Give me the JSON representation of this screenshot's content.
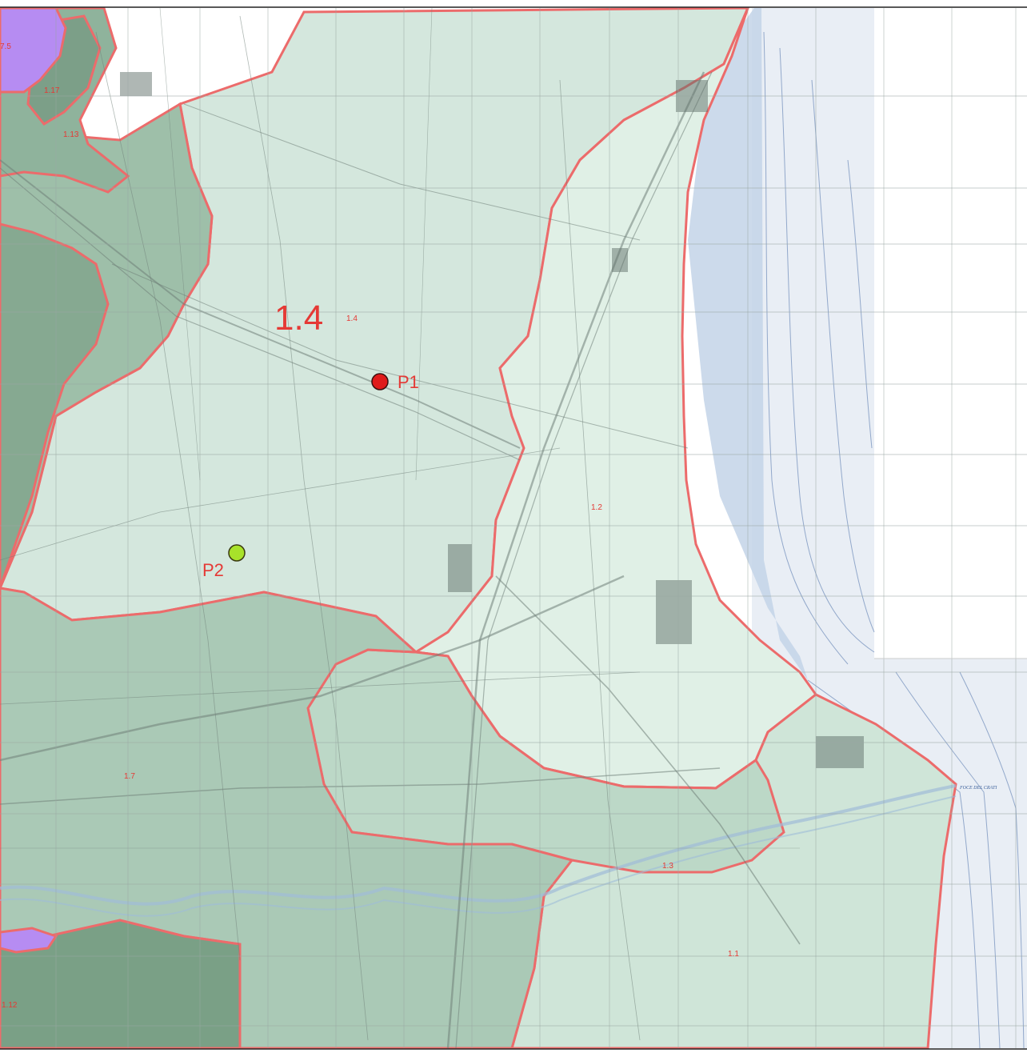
{
  "map": {
    "zone_labels": {
      "z_1_4_big": "1.4",
      "z_1_4": "1.4",
      "z_1_2": "1.2",
      "z_1_3": "1.3",
      "z_1_1": "1.1",
      "z_1_7": "1.7",
      "z_1_12": "1.12",
      "z_1_13": "1.13",
      "z_1_17": "1.17",
      "z_7_5": "7.5"
    },
    "points": [
      {
        "label": "P1",
        "color": "#e01b1b"
      },
      {
        "label": "P2",
        "color": "#a8e22a"
      }
    ],
    "place_labels": {
      "river_mouth": "FOCE DEL CRATI"
    },
    "colors": {
      "boundary": "#ec6b6b",
      "label": "#e53935",
      "zone_light": "#d9ebe2",
      "zone_mid": "#b9d4c4",
      "zone_dark": "#8fb39c",
      "zone_darker": "#7aa086",
      "hill_purple": "#b68cf2",
      "sea": "#e9eef5",
      "sea_shallow": "#c3d3e7"
    }
  }
}
